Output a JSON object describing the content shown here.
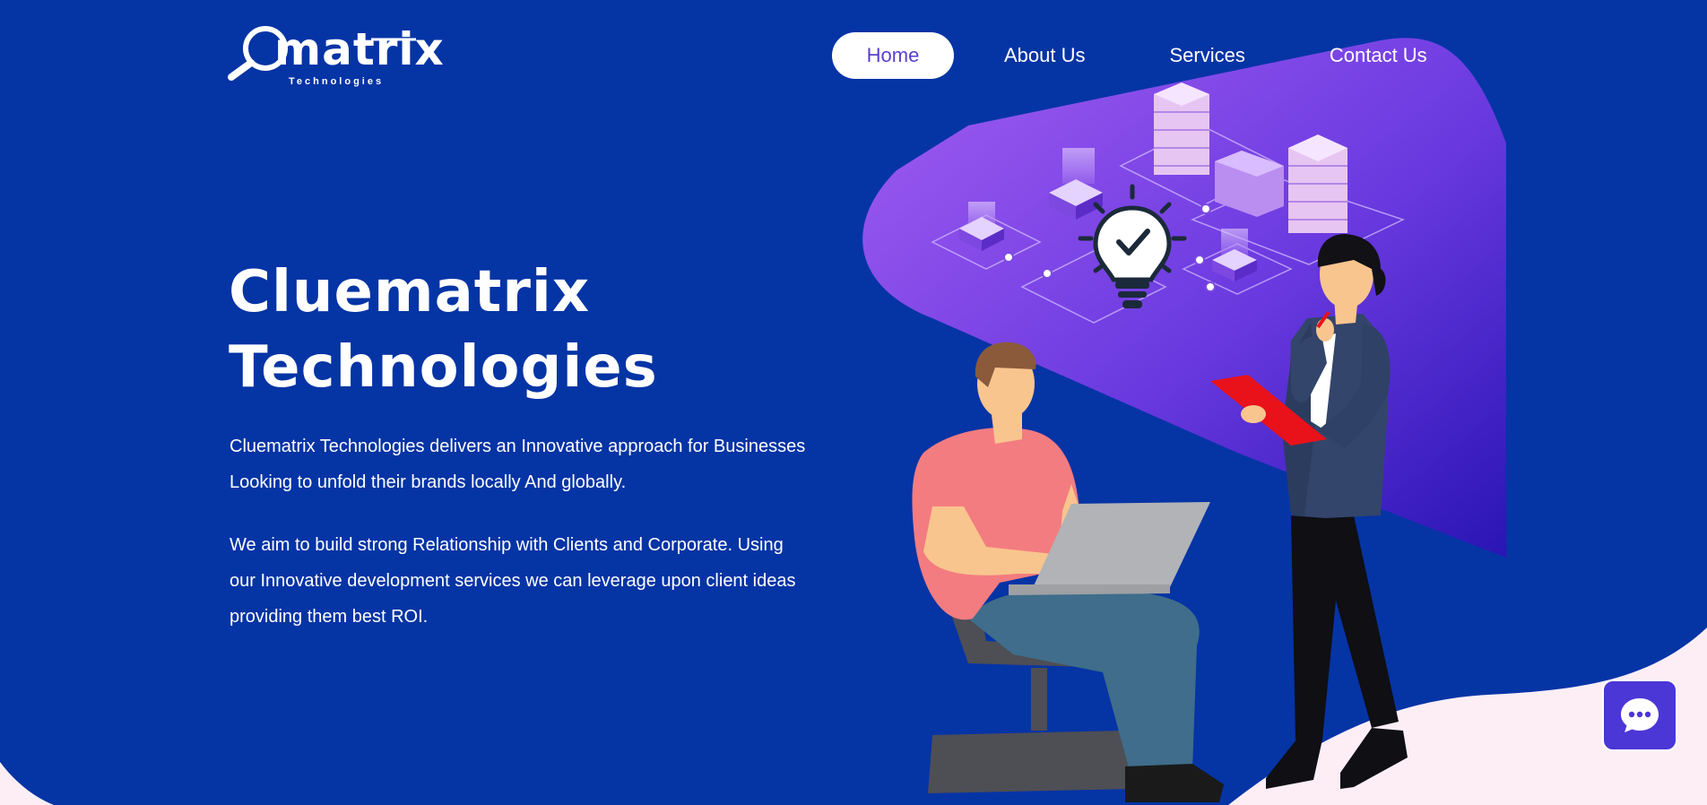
{
  "header": {
    "logo": {
      "wordmark": "matrix",
      "subtitle": "Technologies"
    },
    "nav": [
      {
        "label": "Home",
        "active": true
      },
      {
        "label": "About Us",
        "active": false
      },
      {
        "label": "Services",
        "active": false
      },
      {
        "label": "Contact Us",
        "active": false
      }
    ]
  },
  "hero": {
    "title_line1": "Cluematrix",
    "title_line2": "Technologies",
    "paragraph1_line1": "Cluematrix Technologies delivers an Innovative approach for Businesses",
    "paragraph1_line2": "Looking to unfold their brands locally And globally.",
    "paragraph2_line1": "We aim to build strong Relationship with Clients and Corporate. Using",
    "paragraph2_line2": "our Innovative development services we can leverage upon client ideas",
    "paragraph2_line3": "providing them best ROI."
  },
  "chat_widget": {
    "icon": "chat-bubble-icon"
  },
  "colors": {
    "background": "#0534a5",
    "nav_active_text": "#5a3fd1",
    "chat_button": "#4b36d6",
    "wave": "#fdeef5",
    "panel_gradient_start": "#a25cf0",
    "panel_gradient_end": "#2c16b8"
  }
}
